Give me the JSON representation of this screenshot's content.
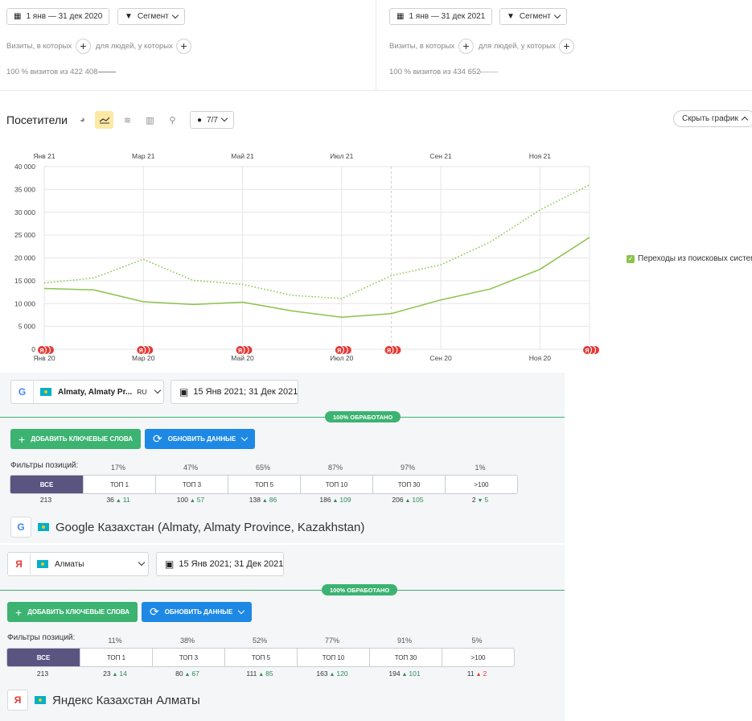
{
  "left_report": {
    "date_range": "1 янв — 31 дек 2020",
    "segment_label": "Сегмент",
    "visits_label": "Визиты, в которых",
    "people_label": "для людей, у которых",
    "summary": "100 % визитов из 422 408"
  },
  "right_report": {
    "date_range": "1 янв — 31 дек 2021",
    "segment_label": "Сегмент",
    "visits_label": "Визиты, в которых",
    "people_label": "для людей, у которых",
    "summary": "100 % визитов из 434 652"
  },
  "chart_header": {
    "title": "Посетители",
    "series_count": "7/7",
    "hide_chart": "Скрыть график"
  },
  "chart_data": {
    "type": "line",
    "top_axis_labels": [
      "Янв 21",
      "Мар 21",
      "Май 21",
      "Июл 21",
      "Сен 21",
      "Ноя 21"
    ],
    "bottom_axis_labels": [
      "Янв 20",
      "Мар 20",
      "Май 20",
      "Июл 20",
      "Сен 20",
      "Ноя 20"
    ],
    "y_ticks": [
      "0",
      "5 000",
      "10 000",
      "15 000",
      "20 000",
      "25 000",
      "30 000",
      "35 000",
      "40 000"
    ],
    "ylim": [
      0,
      40000
    ],
    "legend": "Переходы из поисковых систем",
    "legend_position": "right",
    "grid": true,
    "series": [
      {
        "name": "2021",
        "style": "dotted",
        "color": "#8bc34a",
        "values": [
          14500,
          15600,
          19700,
          15100,
          14200,
          11800,
          11100,
          16100,
          18500,
          23500,
          30500,
          36000
        ]
      },
      {
        "name": "2020",
        "style": "solid",
        "color": "#8bc34a",
        "values": [
          13300,
          13000,
          10400,
          9800,
          10300,
          8400,
          7000,
          7800,
          10800,
          13200,
          17500,
          24500
        ]
      }
    ],
    "annotation_months": [
      0,
      2,
      4,
      6,
      7,
      11
    ],
    "annotation_mark": "Я"
  },
  "google_panel": {
    "location": "Almaty, Almaty Pr...",
    "lang": "RU",
    "date_range": "15 Янв 2021; 31 Дек 2021",
    "processed": "100% ОБРАБОТАНО",
    "add_keywords": "ДОБАВИТЬ КЛЮЧЕВЫЕ СЛОВА",
    "refresh": "ОБНОВИТЬ ДАННЫЕ",
    "filters_label": "Фильтры позиций:",
    "tabs": [
      {
        "label": "ВСЕ",
        "pct": "",
        "count": "213",
        "delta": "",
        "dir": ""
      },
      {
        "label": "ТОП 1",
        "pct": "17%",
        "count": "36",
        "delta": "11",
        "dir": "up"
      },
      {
        "label": "ТОП 3",
        "pct": "47%",
        "count": "100",
        "delta": "57",
        "dir": "up"
      },
      {
        "label": "ТОП 5",
        "pct": "65%",
        "count": "138",
        "delta": "86",
        "dir": "up"
      },
      {
        "label": "ТОП 10",
        "pct": "87%",
        "count": "186",
        "delta": "109",
        "dir": "up"
      },
      {
        "label": "ТОП 30",
        "pct": "97%",
        "count": "206",
        "delta": "105",
        "dir": "up"
      },
      {
        "label": ">100",
        "pct": "1%",
        "count": "2",
        "delta": "5",
        "dir": "down"
      }
    ],
    "engine_title": "Google Казахстан (Almaty, Almaty Province, Kazakhstan)"
  },
  "yandex_panel": {
    "location": "Алматы",
    "date_range": "15 Янв 2021; 31 Дек 2021",
    "processed": "100% ОБРАБОТАНО",
    "add_keywords": "ДОБАВИТЬ КЛЮЧЕВЫЕ СЛОВА",
    "refresh": "ОБНОВИТЬ ДАННЫЕ",
    "filters_label": "Фильтры позиций:",
    "tabs": [
      {
        "label": "ВСЕ",
        "pct": "",
        "count": "213",
        "delta": "",
        "dir": ""
      },
      {
        "label": "ТОП 1",
        "pct": "11%",
        "count": "23",
        "delta": "14",
        "dir": "up"
      },
      {
        "label": "ТОП 3",
        "pct": "38%",
        "count": "80",
        "delta": "67",
        "dir": "up"
      },
      {
        "label": "ТОП 5",
        "pct": "52%",
        "count": "111",
        "delta": "85",
        "dir": "up"
      },
      {
        "label": "ТОП 10",
        "pct": "77%",
        "count": "163",
        "delta": "120",
        "dir": "up"
      },
      {
        "label": "ТОП 30",
        "pct": "91%",
        "count": "194",
        "delta": "101",
        "dir": "up"
      },
      {
        "label": ">100",
        "pct": "5%",
        "count": "11",
        "delta": "2",
        "dir": "up-red"
      }
    ],
    "engine_title": "Яндекс Казахстан Алматы"
  }
}
